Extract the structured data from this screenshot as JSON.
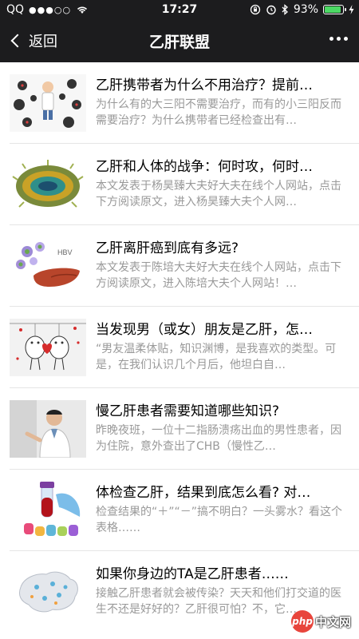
{
  "status": {
    "carrier": "QQ",
    "signal": "●●●○○",
    "time": "17:27",
    "battery": "93%",
    "battery_level": 0.93
  },
  "nav": {
    "back_label": "返回",
    "title": "乙肝联盟"
  },
  "articles": [
    {
      "title": "乙肝携带者为什么不用治疗？提前…",
      "desc": "为什么有的大三阳不需要治疗，而有的小三阳反而需要治疗？为什么携带者已经检查出有…"
    },
    {
      "title": "乙肝和人体的战争：何时攻，何时…",
      "desc": "本文发表于杨昊臻大夫好大夫在线个人网站，点击下方阅读原文，进入杨昊臻大夫个人网…"
    },
    {
      "title": "乙肝离肝癌到底有多远?",
      "desc": "本文发表于陈培大夫好大夫在线个人网站，点击下方阅读原文，进入陈培大夫个人网站！…"
    },
    {
      "title": "当发现男（或女）朋友是乙肝，怎…",
      "desc": "“男友温柔体贴，知识渊博，是我喜欢的类型。可是，在我们认识几个月后，他坦白自…"
    },
    {
      "title": "慢乙肝患者需要知道哪些知识?",
      "desc": "昨晚夜班，一位十二指肠溃疡出血的男性患者，因为住院，意外查出了CHB（慢性乙…"
    },
    {
      "title": "体检查乙肝，结果到底怎么看? 对…",
      "desc": "检查结果的“＋”“－”搞不明白？一头雾水？看这个表格……"
    },
    {
      "title": "如果你身边的TA是乙肝患者……",
      "desc": "接触乙肝患者就会被传染？天天和他们打交道的医生不还是好好的？乙肝很可怕？不，它…"
    }
  ],
  "thumbs": [
    "doctor-virus-illustration",
    "virus-3d-illustration",
    "hbv-liver-illustration",
    "couple-cartoon",
    "doctor-photo",
    "blood-test-tubes",
    "china-map-illustration"
  ],
  "watermark": {
    "badge": "php",
    "text": "中文网"
  },
  "colors": {
    "bar": "#1c1c1e",
    "desc": "#999999",
    "battery": "#4cd964",
    "divider": "#e5e5e5"
  }
}
